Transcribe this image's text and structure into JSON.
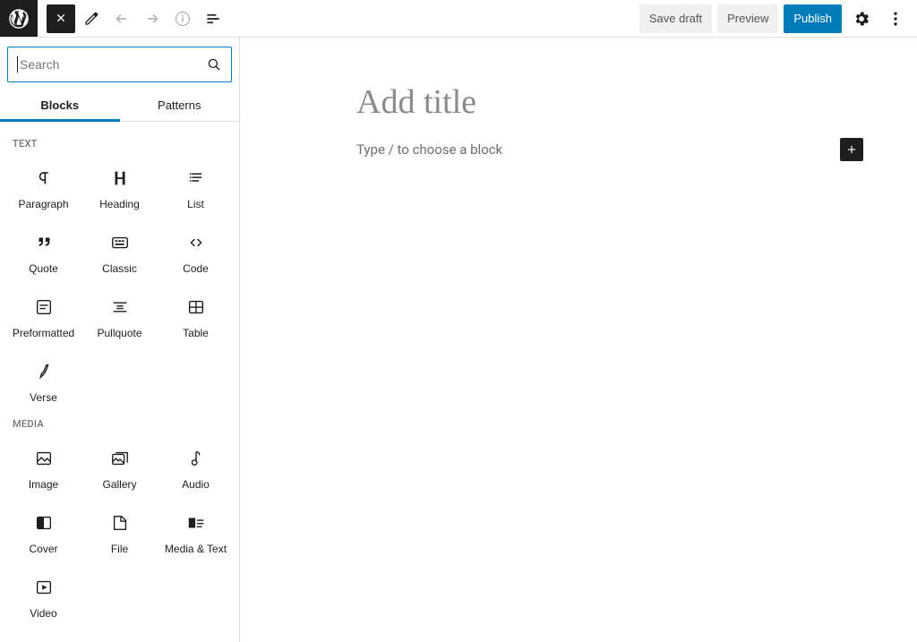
{
  "topbar": {
    "save_draft": "Save draft",
    "preview": "Preview",
    "publish": "Publish"
  },
  "inserter": {
    "search_placeholder": "Search",
    "tabs": {
      "blocks": "Blocks",
      "patterns": "Patterns"
    },
    "categories": [
      {
        "label": "TEXT",
        "blocks": [
          {
            "label": "Paragraph",
            "icon": "paragraph"
          },
          {
            "label": "Heading",
            "icon": "heading"
          },
          {
            "label": "List",
            "icon": "list"
          },
          {
            "label": "Quote",
            "icon": "quote"
          },
          {
            "label": "Classic",
            "icon": "classic"
          },
          {
            "label": "Code",
            "icon": "code"
          },
          {
            "label": "Preformatted",
            "icon": "preformatted"
          },
          {
            "label": "Pullquote",
            "icon": "pullquote"
          },
          {
            "label": "Table",
            "icon": "table"
          },
          {
            "label": "Verse",
            "icon": "verse"
          }
        ]
      },
      {
        "label": "MEDIA",
        "blocks": [
          {
            "label": "Image",
            "icon": "image"
          },
          {
            "label": "Gallery",
            "icon": "gallery"
          },
          {
            "label": "Audio",
            "icon": "audio"
          },
          {
            "label": "Cover",
            "icon": "cover"
          },
          {
            "label": "File",
            "icon": "file"
          },
          {
            "label": "Media & Text",
            "icon": "media-text"
          },
          {
            "label": "Video",
            "icon": "video"
          }
        ]
      }
    ]
  },
  "editor": {
    "title_placeholder": "Add title",
    "block_placeholder": "Type / to choose a block"
  }
}
